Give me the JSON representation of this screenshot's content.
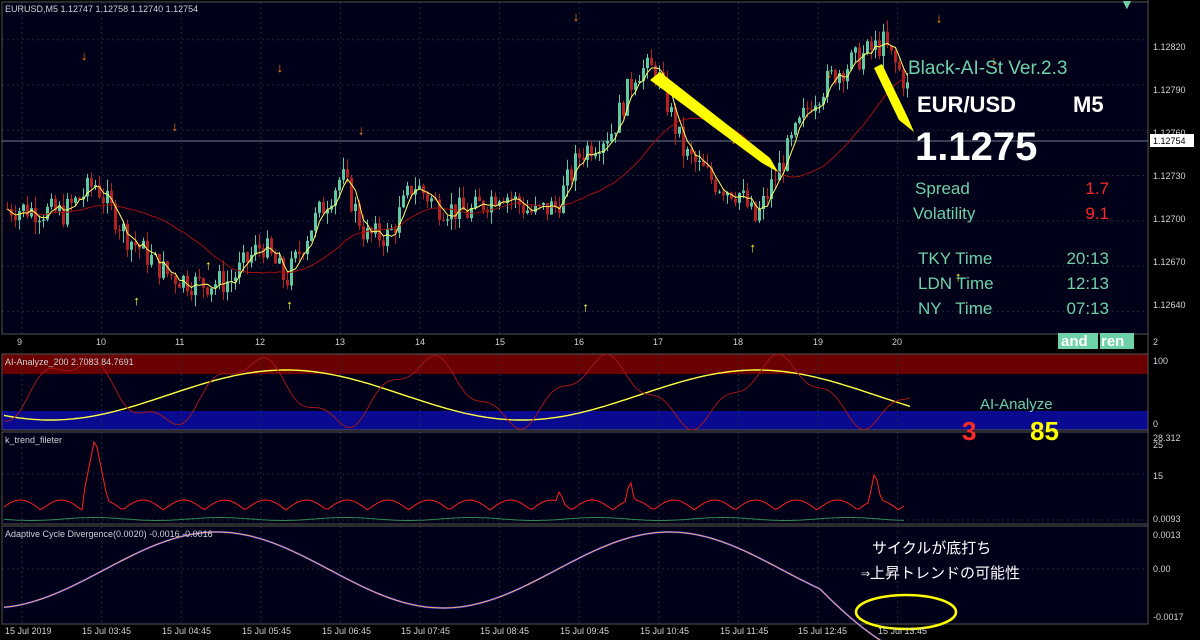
{
  "colors": {
    "bg": "#000018",
    "bull": "#5fc9a3",
    "bear": "#b22222",
    "ma_fast": "#ffff66",
    "ma_slow": "#a01010",
    "arrow_down": "#ff8c1a",
    "arrow_up": "#ffff33",
    "info_green": "#6fd1a8",
    "info_red": "#ff2a2a",
    "ai_red_band": "#6b0000",
    "ai_blue_band": "#0a0a90",
    "acd_line1": "#2a2aff",
    "acd_line2": "#ffb347",
    "callout": "#ffff00"
  },
  "main": {
    "title": "EURUSD,M5  1.12747 1.12758 1.12740 1.12754",
    "price_ticks": [
      "1.12820",
      "1.12790",
      "1.12760",
      "1.12730",
      "1.12700",
      "1.12670",
      "1.12640"
    ],
    "current_price": "1.12754",
    "date_ticks": [
      "9",
      "10",
      "11",
      "12",
      "13",
      "14",
      "15",
      "16",
      "17",
      "18",
      "19",
      "20"
    ]
  },
  "info_panel": {
    "name": "Black-AI-St Ver.2.3",
    "pair": "EUR/USD",
    "timeframe": "M5",
    "price": "1.1275",
    "spread_label": "Spread",
    "spread_value": "1.7",
    "volatility_label": "Volatility",
    "volatility_value": "9.1",
    "tky_label": "TKY Time",
    "tky_value": "20:13",
    "ldn_label": "LDN Time",
    "ldn_value": "12:13",
    "ny_label": "NY   Time",
    "ny_value": "07:13",
    "badge_left": "and",
    "badge_right": "ren",
    "stray_2": "2"
  },
  "ai_panel": {
    "title": "AI-Analyze_200 2.7083 84.7691",
    "label": "AI-Analyze",
    "value_left": "3",
    "value_right": "85",
    "tick_top": "100",
    "tick_bottom": "0"
  },
  "ktrend_panel": {
    "title": "k_trend_fileter",
    "tick_top": "25",
    "tick_top_extra": "28.312",
    "tick_mid": "15",
    "tick_bottom": "0.0093"
  },
  "acd_panel": {
    "title": "Adaptive Cycle Divergence(0.0020) -0.0016 -0.0016",
    "tick_top": "0.0013",
    "tick_mid": "0.00",
    "tick_bottom": "-0.0017",
    "note_line1": "サイクルが底打ち",
    "note_line2": "⇒上昇トレンドの可能性"
  },
  "time_axis": [
    "15 Jul 2019",
    "15 Jul 03:45",
    "15 Jul 04:45",
    "15 Jul 05:45",
    "15 Jul 06:45",
    "15 Jul 07:45",
    "15 Jul 08:45",
    "15 Jul 09:45",
    "15 Jul 10:45",
    "15 Jul 11:45",
    "15 Jul 12:45",
    "15 Jul 13:45"
  ],
  "chart_data": {
    "type": "candlestick",
    "symbol": "EURUSD",
    "timeframe": "M5",
    "ylim": [
      1.12625,
      1.12845
    ],
    "price_levels": [
      1.1282,
      1.1279,
      1.1276,
      1.1273,
      1.127,
      1.1267,
      1.1264
    ],
    "current_price": 1.12754,
    "arrows_down_x": [
      1.3,
      3.2,
      5.4,
      7.1,
      11.6,
      14.9,
      16.9,
      19.2,
      20.35
    ],
    "arrows_up_x": [
      2.4,
      3.9,
      5.6,
      11.8,
      15.3,
      19.6
    ],
    "ai_panel": {
      "ylim": [
        0,
        100
      ],
      "last_values": [
        2.7083,
        84.7691
      ]
    },
    "ktrend_panel": {
      "ylim": [
        0,
        25
      ]
    },
    "acd_panel": {
      "ylim": [
        -0.0017,
        0.0013
      ],
      "last_value": -0.0016
    }
  }
}
